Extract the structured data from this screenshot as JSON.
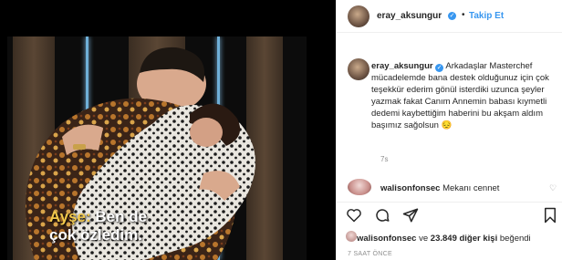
{
  "video": {
    "caption_speaker": "Ayşe:",
    "caption_line1": "Ben de",
    "caption_line2": "çok özledim."
  },
  "header": {
    "username": "eray_aksungur",
    "separator": "•",
    "follow_label": "Takip Et"
  },
  "caption": {
    "username": "eray_aksungur",
    "text": "Arkadaşlar Masterchef mücadelemde bana destek olduğunuz için çok teşekkür ederim gönül isterdiki uzunca şeyler yazmak fakat Canım Annemin babası kıymetli dedemi kaybettiğim haberini bu akşam aldım başımız sağolsun 😔",
    "time": "7s"
  },
  "reply": {
    "username": "walisonfonsec",
    "text": "Mekanı cennet"
  },
  "likes": {
    "username": "walisonfonsec",
    "connector": "ve",
    "count": "23.849 diğer kişi",
    "suffix": "beğendi"
  },
  "post_time": "7 SAAT ÖNCE",
  "icons": [
    "heart-icon",
    "comment-icon",
    "share-icon",
    "bookmark-icon",
    "verified-badge-icon",
    "small-heart-icon"
  ]
}
